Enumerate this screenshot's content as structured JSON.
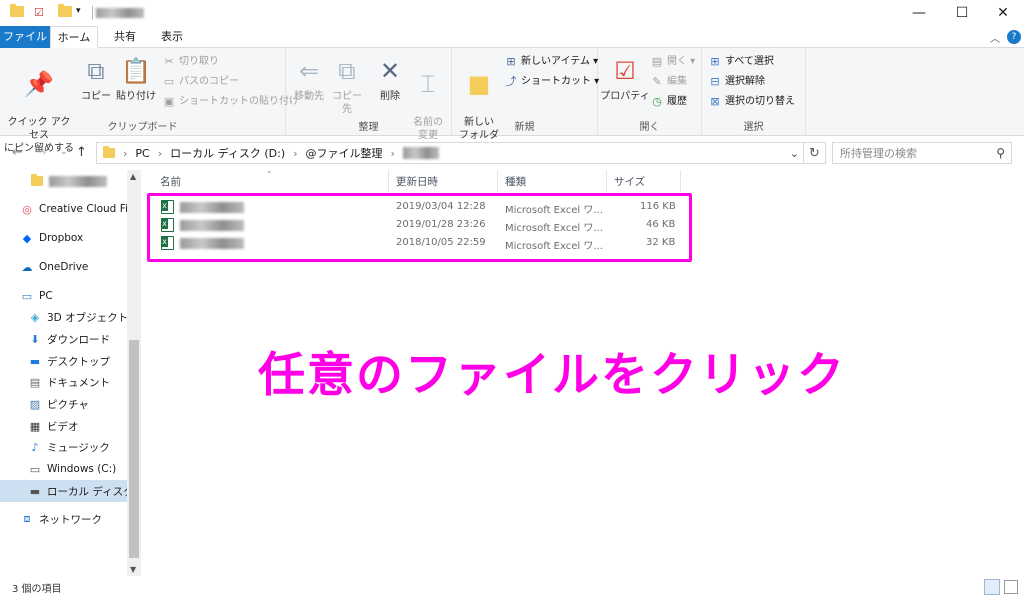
{
  "window": {
    "path_tail_blurred": "",
    "controls": {
      "minimize": "—",
      "maximize": "☐",
      "close": "✕"
    },
    "help": "?",
    "collapse": "︿"
  },
  "ribbon_tabs": [
    "ファイル",
    "ホーム",
    "共有",
    "表示"
  ],
  "ribbon": {
    "clipboard": {
      "pin": "クイック アクセス\nにピン留めする",
      "copy": "コピー",
      "paste": "貼り付け",
      "cut": "切り取り",
      "copy_path": "パスのコピー",
      "paste_shortcut": "ショートカットの貼り付け",
      "label": "クリップボード"
    },
    "organize": {
      "move": "移動先",
      "copy_to": "コピー先",
      "delete": "削除",
      "rename": "名前の\n変更",
      "label": "整理"
    },
    "new": {
      "new_folder": "新しい\nフォルダー",
      "new_item": "新しいアイテム ▾",
      "shortcut": "ショートカット ▾",
      "label": "新規"
    },
    "open": {
      "properties": "プロパティ",
      "open": "開く ▾",
      "edit": "編集",
      "history": "履歴",
      "label": "開く"
    },
    "select": {
      "select_all": "すべて選択",
      "select_none": "選択解除",
      "invert": "選択の切り替え",
      "label": "選択"
    }
  },
  "address": {
    "crumbs": [
      "PC",
      "ローカル ディスク (D:)",
      "@ファイル整理"
    ],
    "search_placeholder": "所持管理の検索"
  },
  "nav": [
    {
      "label": "",
      "icon": "folder-icon",
      "blurred": true
    },
    {
      "label": "Creative Cloud Files",
      "icon": "creative-cloud-icon"
    },
    {
      "label": "Dropbox",
      "icon": "dropbox-icon"
    },
    {
      "label": "OneDrive",
      "icon": "onedrive-icon"
    },
    {
      "label": "PC",
      "icon": "pc-icon"
    },
    {
      "label": "3D オブジェクト",
      "icon": "3d-objects-icon"
    },
    {
      "label": "ダウンロード",
      "icon": "download-icon"
    },
    {
      "label": "デスクトップ",
      "icon": "desktop-icon"
    },
    {
      "label": "ドキュメント",
      "icon": "document-icon"
    },
    {
      "label": "ピクチャ",
      "icon": "pictures-icon"
    },
    {
      "label": "ビデオ",
      "icon": "video-icon"
    },
    {
      "label": "ミュージック",
      "icon": "music-icon"
    },
    {
      "label": "Windows (C:)",
      "icon": "drive-icon"
    },
    {
      "label": "ローカル ディスク (D:)",
      "icon": "drive-icon",
      "selected": true
    },
    {
      "label": "ネットワーク",
      "icon": "network-icon"
    }
  ],
  "columns": {
    "name": "名前",
    "modified": "更新日時",
    "type": "種類",
    "size": "サイズ"
  },
  "files": [
    {
      "name": "",
      "modified": "2019/03/04 12:28",
      "type": "Microsoft Excel ワ...",
      "size": "116 KB"
    },
    {
      "name": "",
      "modified": "2019/01/28 23:26",
      "type": "Microsoft Excel ワ...",
      "size": "46 KB"
    },
    {
      "name": "",
      "modified": "2018/10/05 22:59",
      "type": "Microsoft Excel ワ...",
      "size": "32 KB"
    }
  ],
  "annotation": "任意のファイルをクリック",
  "annotation_color": "#ff00e6",
  "status": {
    "item_count": "3 個の項目"
  },
  "colors": {
    "file_tab": "#1979ca",
    "selected_nav": "#cde0f2",
    "excel_green": "#1e7145"
  }
}
